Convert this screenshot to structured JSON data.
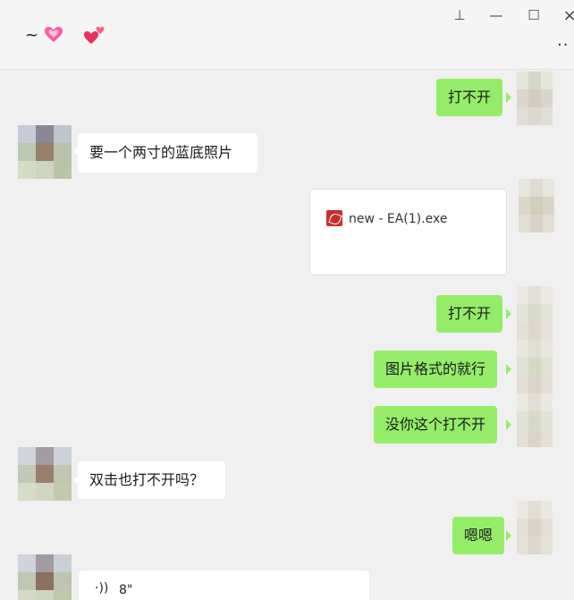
{
  "header": {
    "title_prefix": "~",
    "pin_symbol": "⊥",
    "minimize_symbol": "—",
    "maximize_symbol": "☐",
    "close_symbol": "×",
    "more_symbol": "··",
    "heart_icon_1": "sparkling-heart-icon",
    "heart_icon_2": "two-hearts-icon"
  },
  "messages": [
    {
      "side": "right",
      "type": "text",
      "text": "打不开"
    },
    {
      "side": "left",
      "type": "text",
      "text": "要一个两寸的蓝底照片"
    },
    {
      "side": "right",
      "type": "file",
      "file_name": "new - EA(1).exe",
      "file_icon": "pdf-file-icon"
    },
    {
      "side": "right",
      "type": "text",
      "text": "打不开"
    },
    {
      "side": "right",
      "type": "text",
      "text": "图片格式的就行"
    },
    {
      "side": "right",
      "type": "text",
      "text": "没你这个打不开"
    },
    {
      "side": "left",
      "type": "text",
      "text": "双击也打不开吗？"
    },
    {
      "side": "right",
      "type": "text",
      "text": "嗯嗯"
    },
    {
      "side": "left",
      "type": "voice",
      "voice_symbol": "·))",
      "duration": "8\""
    }
  ],
  "colors": {
    "sent_bubble": "#95ec69",
    "received_bubble": "#ffffff",
    "background": "#f0f0f0"
  }
}
